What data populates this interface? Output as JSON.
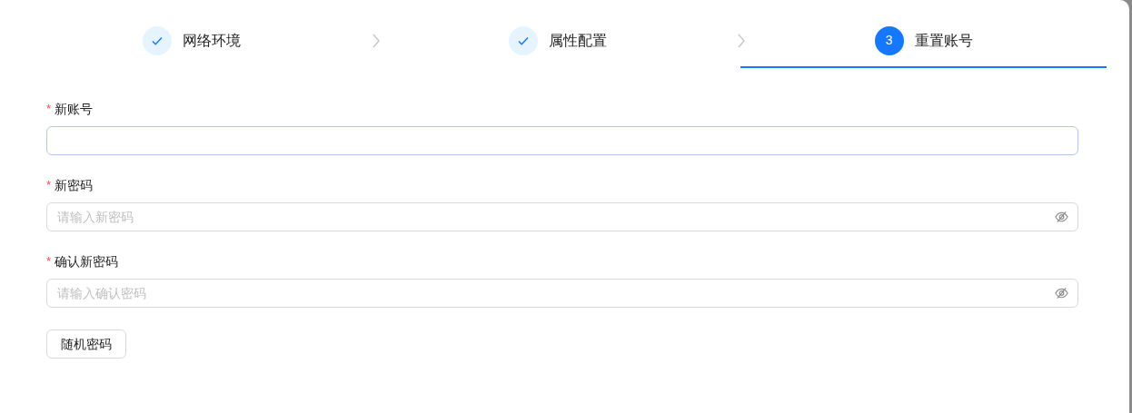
{
  "steps": [
    {
      "label": "网络环境",
      "done": true,
      "selected": false
    },
    {
      "label": "属性配置",
      "done": true,
      "selected": false
    },
    {
      "label": "重置账号",
      "done": false,
      "number": "3",
      "selected": true
    }
  ],
  "fields": [
    {
      "label": "新账号",
      "required_mark": "*",
      "kind": "text",
      "focused": true
    },
    {
      "label": "新密码",
      "required_mark": "*",
      "kind": "password",
      "placeholder": "请输入新密码",
      "focused": false
    },
    {
      "label": "确认新密码",
      "required_mark": "*",
      "kind": "password",
      "placeholder": "请输入确认密码",
      "focused": false
    }
  ],
  "button": "随机密码"
}
